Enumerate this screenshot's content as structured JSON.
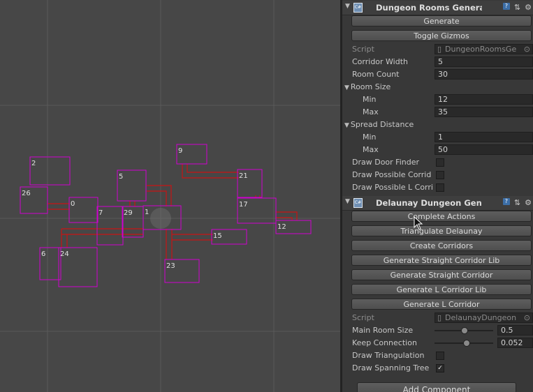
{
  "scene": {
    "rooms": [
      {
        "label": "2"
      },
      {
        "label": "26"
      },
      {
        "label": "0"
      },
      {
        "label": "5"
      },
      {
        "label": "29"
      },
      {
        "label": "1"
      },
      {
        "label": "7"
      },
      {
        "label": "6"
      },
      {
        "label": "24"
      },
      {
        "label": "9"
      },
      {
        "label": "21"
      },
      {
        "label": "17"
      },
      {
        "label": "12"
      },
      {
        "label": "15"
      },
      {
        "label": "23"
      }
    ],
    "colors": {
      "room": "#d000d0",
      "corridor": "#c81414",
      "grid": "#5a5a5a",
      "background": "#474747"
    }
  },
  "inspector": {
    "dungeon_rooms": {
      "title": "Dungeon Rooms Genera",
      "buttons": {
        "generate": "Generate",
        "toggle_gizmos": "Toggle Gizmos"
      },
      "script": {
        "label": "Script",
        "value": "DungeonRoomsGe"
      },
      "corridor_width": {
        "label": "Corridor Width",
        "value": "5"
      },
      "room_count": {
        "label": "Room Count",
        "value": "30"
      },
      "room_size": {
        "label": "Room Size",
        "min_label": "Min",
        "min": "12",
        "max_label": "Max",
        "max": "35"
      },
      "spread_distance": {
        "label": "Spread Distance",
        "min_label": "Min",
        "min": "1",
        "max_label": "Max",
        "max": "50"
      },
      "toggles": {
        "door_finder": "Draw Door Finder",
        "possible_corridors": "Draw Possible Corrid",
        "possible_l": "Draw Possible L Corri"
      }
    },
    "delaunay": {
      "title": "Delaunay Dungeon Gen",
      "buttons": {
        "complete_actions": "Complete Actions",
        "triangulate": "Triangulate Delaunay",
        "create_corridors": "Create Corridors",
        "straight_lib": "Generate Straight Corridor Lib",
        "straight": "Generate Straight Corridor",
        "l_lib": "Generate L Corridor Lib",
        "l": "Generate L Corridor"
      },
      "script": {
        "label": "Script",
        "value": "DelaunayDungeon"
      },
      "main_room_size": {
        "label": "Main Room Size",
        "value": "0.5",
        "level": 0.5
      },
      "keep_connection": {
        "label": "Keep Connection",
        "value": "0.052",
        "level": 0.052
      },
      "draw_triangulation": {
        "label": "Draw Triangulation",
        "checked": false
      },
      "draw_spanning_tree": {
        "label": "Draw Spanning Tree",
        "checked": true
      }
    },
    "add_component": "Add Component"
  }
}
